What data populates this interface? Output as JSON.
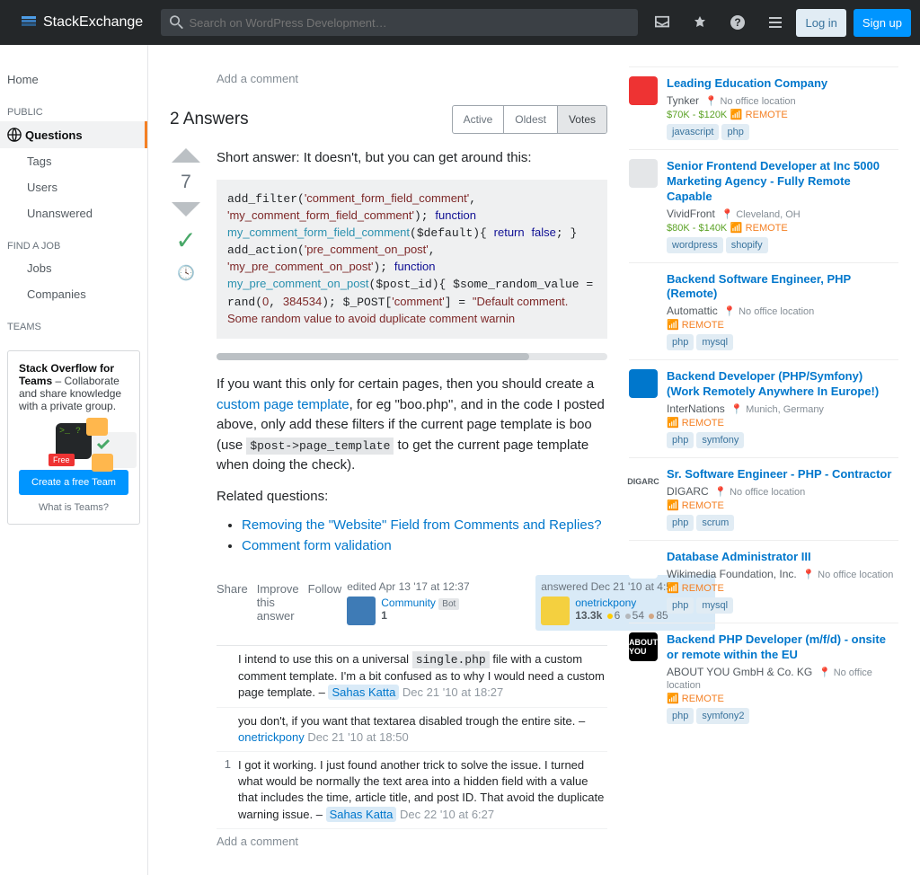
{
  "topbar": {
    "logo_text": "StackExchange",
    "search_placeholder": "Search on WordPress Development…",
    "login": "Log in",
    "signup": "Sign up"
  },
  "leftnav": {
    "home": "Home",
    "public": "PUBLIC",
    "questions": "Questions",
    "tags": "Tags",
    "users": "Users",
    "unanswered": "Unanswered",
    "findjob": "FIND A JOB",
    "jobs": "Jobs",
    "companies": "Companies",
    "teams": "TEAMS",
    "teams_title": "Stack Overflow for Teams",
    "teams_desc": " – Collaborate and share knowledge with a private group.",
    "teams_btn": "Create a free Team",
    "teams_link": "What is Teams?",
    "free_badge": "Free"
  },
  "main": {
    "addcomment_top": "Add a comment",
    "answers_count": "2 Answers",
    "tabs": {
      "active": "Active",
      "oldest": "Oldest",
      "votes": "Votes"
    },
    "vote_count": "7",
    "answer_intro": "Short answer: It doesn't, but you can get around this:",
    "para2a": "If you want this only for certain pages, then you should create a ",
    "para2link": "custom page template",
    "para2b": ", for eg \"boo.php\", and in the code I posted above, only add these filters if the current page template is boo (use ",
    "para2code": "$post->page_template",
    "para2c": " to get the current page template when doing the check).",
    "related": "Related questions:",
    "rel1": "Removing the \"Website\" Field from Comments and Replies?",
    "rel2": "Comment form validation",
    "menu": {
      "share": "Share",
      "improve": "Improve this answer",
      "follow": "Follow"
    },
    "edit_when": "edited Apr 13 '17 at 12:37",
    "edit_user": "Community",
    "edit_flair": "Bot",
    "edit_rep": "1",
    "ans_when": "answered Dec 21 '10 at 4:51",
    "ans_user": "onetrickpony",
    "ans_rep": "13.3k",
    "ans_gold": "6",
    "ans_silver": "54",
    "ans_bronze": "85",
    "c1a": "I intend to use this on a universal ",
    "c1code": "single.php",
    "c1b": " file with a custom comment template. I'm a bit confused as to why I would need a custom page template. – ",
    "c1user": "Sahas Katta",
    "c1date": "Dec 21 '10 at 18:27",
    "c2a": "you don't, if you want that textarea disabled trough the entire site. – ",
    "c2user": "onetrickpony",
    "c2date": "Dec 21 '10 at 18:50",
    "c3score": "1",
    "c3a": "I got it working. I just found another trick to solve the issue. I turned what would be normally the text area into a hidden field with a value that includes the time, article title, and post ID. That avoid the duplicate warning issue. – ",
    "c3user": "Sahas Katta",
    "c3date": "Dec 22 '10 at 6:27",
    "addcomment_bot": "Add a comment"
  },
  "jobs": [
    {
      "title": "Leading Education Company",
      "company": "Tynker",
      "loc": "No office location",
      "sal": "$70K - $120K",
      "remote": "REMOTE",
      "tags": [
        "javascript",
        "php"
      ],
      "icon": "",
      "iconbg": "#e33"
    },
    {
      "title": "Senior Frontend Developer at Inc 5000 Marketing Agency - Fully Remote Capable",
      "company": "VividFront",
      "loc": "Cleveland, OH",
      "sal": "$80K - $140K",
      "remote": "REMOTE",
      "tags": [
        "wordpress",
        "shopify"
      ],
      "icon": "",
      "iconbg": "#e4e6e8"
    },
    {
      "title": "Backend Software Engineer, PHP (Remote)",
      "company": "Automattic",
      "loc": "No office location",
      "sal": "",
      "remote": "REMOTE",
      "tags": [
        "php",
        "mysql"
      ],
      "icon": "",
      "iconbg": "#fff"
    },
    {
      "title": "Backend Developer (PHP/Symfony) (Work Remotely Anywhere In Europe!)",
      "company": "InterNations",
      "loc": "Munich, Germany",
      "sal": "",
      "remote": "REMOTE",
      "tags": [
        "php",
        "symfony"
      ],
      "icon": "",
      "iconbg": "#0077cc"
    },
    {
      "title": "Sr. Software Engineer - PHP - Contractor",
      "company": "DIGARC",
      "loc": "No office location",
      "sal": "",
      "remote": "REMOTE",
      "tags": [
        "php",
        "scrum"
      ],
      "icon": "DIGARC",
      "iconbg": "#fff"
    },
    {
      "title": "Database Administrator III",
      "company": "Wikimedia Foundation, Inc.",
      "loc": "No office location",
      "sal": "",
      "remote": "REMOTE",
      "tags": [
        "php",
        "mysql"
      ],
      "icon": "",
      "iconbg": "#fff"
    },
    {
      "title": "Backend PHP Developer (m/f/d) - onsite or remote within the EU",
      "company": "ABOUT YOU GmbH & Co. KG",
      "loc": "No office location",
      "sal": "",
      "remote": "REMOTE",
      "tags": [
        "php",
        "symfony2"
      ],
      "icon": "ABOUT YOU",
      "iconbg": "#000"
    }
  ]
}
